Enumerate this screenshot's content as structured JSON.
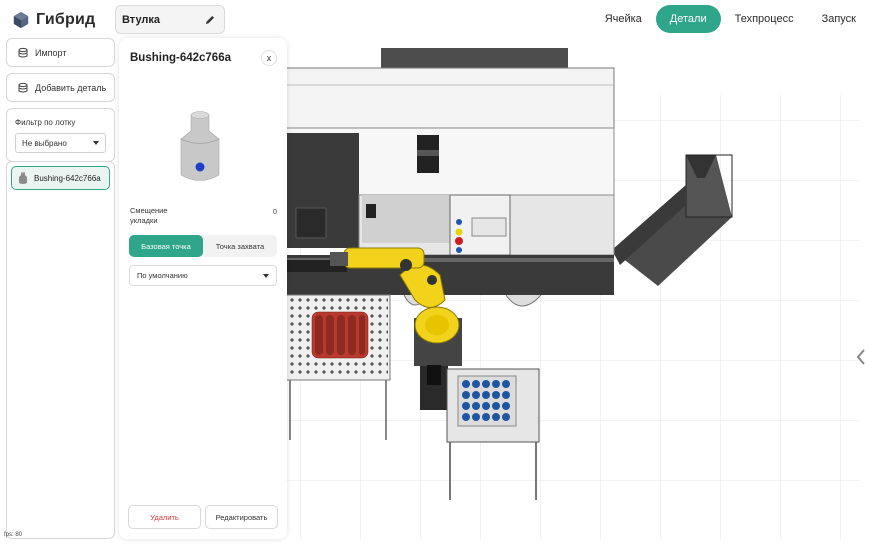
{
  "app": {
    "name": "Гибрид"
  },
  "header": {
    "detail_name": "Втулка",
    "nav": [
      {
        "label": "Ячейка",
        "active": false
      },
      {
        "label": "Детали",
        "active": true
      },
      {
        "label": "Техпроцесс",
        "active": false
      },
      {
        "label": "Запуск",
        "active": false
      }
    ]
  },
  "sidebar": {
    "import_label": "Импорт",
    "add_part_label": "Добавить деталь",
    "filter": {
      "label": "Фильтр по лотку",
      "value": "Не выбрано"
    },
    "parts": [
      {
        "label": "Bushing-642c766a",
        "selected": true
      }
    ]
  },
  "detail_panel": {
    "title": "Bushing-642c766a",
    "close_label": "x",
    "offset_label": "Смещение укладки",
    "offset_value": "0",
    "segments": {
      "base_point": "Базовая точка",
      "grip_point": "Точка захвата",
      "active": "base_point"
    },
    "mode_select": "По умолчанию",
    "delete_label": "Удалить",
    "edit_label": "Редактировать"
  },
  "status": {
    "fps": "fps: 80"
  },
  "colors": {
    "accent": "#2fa58a",
    "danger": "#d93b3b",
    "robot": "#f2d21b",
    "red_parts": "#b83a2e",
    "blue_parts": "#1e56a0"
  },
  "icons": {
    "logo": "cube-logo-icon",
    "pencil": "pencil-icon",
    "import": "database-icon",
    "add": "database-icon",
    "part": "bushing-icon",
    "close": "close-icon",
    "collapse": "chevron-left-icon"
  }
}
